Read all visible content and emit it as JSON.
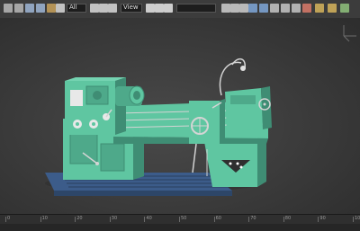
{
  "toolbar": {
    "selection_filter": "All",
    "view_mode": "View",
    "named_selection": "",
    "icons": [
      {
        "name": "undo-icon",
        "color": "#b8b8b8"
      },
      {
        "name": "redo-icon",
        "color": "#b8b8b8"
      },
      {
        "name": "link-icon",
        "color": "#9fb6d6"
      },
      {
        "name": "unlink-icon",
        "color": "#9fb6d6"
      },
      {
        "name": "bind-space-warp-icon",
        "color": "#c8a15a"
      },
      {
        "name": "select-object-icon",
        "color": "#d9d9d9"
      },
      {
        "name": "select-by-name-icon",
        "color": "#d9d9d9"
      },
      {
        "name": "rect-selection-icon",
        "color": "#d9d9d9"
      },
      {
        "name": "window-crossing-icon",
        "color": "#d9d9d9"
      },
      {
        "name": "select-move-icon",
        "color": "#e6e6e6"
      },
      {
        "name": "select-rotate-icon",
        "color": "#e6e6e6"
      },
      {
        "name": "select-scale-icon",
        "color": "#e6e6e6"
      },
      {
        "name": "snap-toggle-icon",
        "color": "#cfcfcf"
      },
      {
        "name": "angle-snap-icon",
        "color": "#cfcfcf"
      },
      {
        "name": "percent-snap-icon",
        "color": "#cfcfcf"
      },
      {
        "name": "mirror-icon",
        "color": "#7fa7d9"
      },
      {
        "name": "align-icon",
        "color": "#7fa7d9"
      },
      {
        "name": "layer-manager-icon",
        "color": "#c6c6c6"
      },
      {
        "name": "curve-editor-icon",
        "color": "#c6c6c6"
      },
      {
        "name": "schematic-view-icon",
        "color": "#c6c6c6"
      },
      {
        "name": "material-editor-icon",
        "color": "#d97a6a"
      },
      {
        "name": "render-setup-icon",
        "color": "#d6b45c"
      },
      {
        "name": "rendered-frame-icon",
        "color": "#d6b45c"
      },
      {
        "name": "render-production-icon",
        "color": "#8fc27c"
      }
    ]
  },
  "viewport": {
    "label": "",
    "background": "#3a3a3a"
  },
  "model": {
    "body_color": "#5fc6a1",
    "shadow_color": "#3f8d74",
    "base_color": "#3c5c8a",
    "detail_color": "#d4d4d4"
  },
  "timeline": {
    "ticks": [
      "0",
      "10",
      "20",
      "30",
      "40",
      "50",
      "60",
      "70",
      "80",
      "90",
      "100"
    ]
  },
  "status": {
    "left": "",
    "middle": "",
    "right": ""
  }
}
